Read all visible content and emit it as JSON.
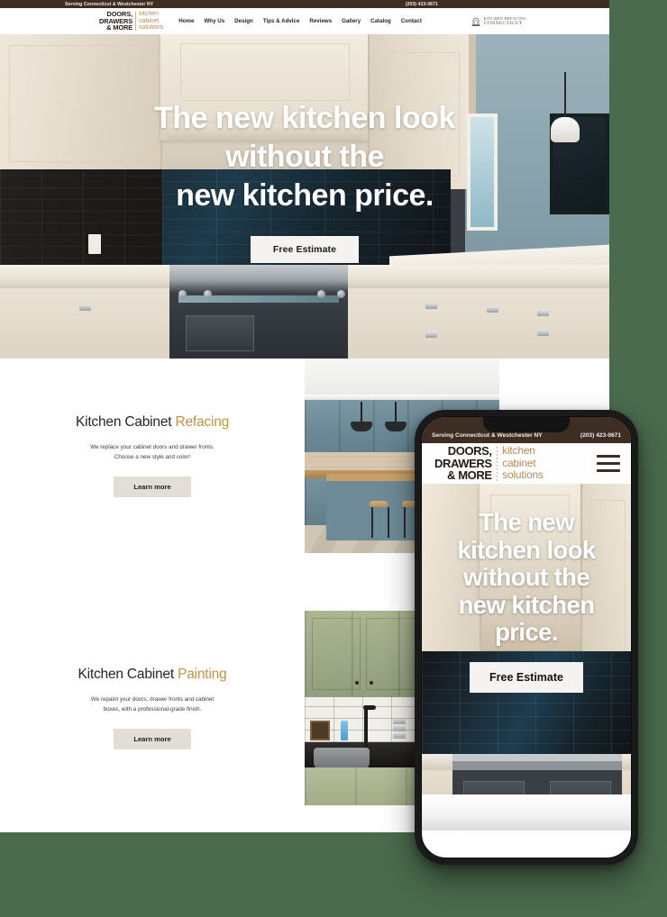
{
  "desktop": {
    "topbar": {
      "tagline": "Serving Connecticut & Westchester NY",
      "phone": "(203) 423-0671"
    },
    "logo": {
      "line1": "DOORS,",
      "line2": "DRAWERS",
      "line3": "& MORE",
      "sub1": "kitchen",
      "sub2": "cabinet",
      "sub3": "solutions"
    },
    "nav": [
      {
        "label": "Home"
      },
      {
        "label": "Why Us"
      },
      {
        "label": "Design"
      },
      {
        "label": "Tips & Advice"
      },
      {
        "label": "Reviews"
      },
      {
        "label": "Gallery"
      },
      {
        "label": "Catalog"
      },
      {
        "label": "Contact"
      }
    ],
    "partner_badge": {
      "line1": "KITCHEN REFACING",
      "line2": "CONNECTICUT"
    },
    "hero": {
      "line1": "The new kitchen look",
      "line2": "without the",
      "line3": "new kitchen price.",
      "cta": "Free Estimate"
    },
    "features": [
      {
        "title_plain": "Kitchen Cabinet ",
        "title_accent": "Refacing",
        "desc_line1": "We replace your cabinet doors and drawer fronts.",
        "desc_line2": "Choose a new style and color!",
        "cta": "Learn more"
      },
      {
        "title_plain": "Kitchen Cabinet ",
        "title_accent": "Painting",
        "desc_line1": "We repaint your doors, drawer fronts and cabinet",
        "desc_line2": "boxes, with a professional-grade finish.",
        "cta": "Learn more"
      }
    ]
  },
  "phone": {
    "topbar": {
      "tagline": "Serving Connecticut & Westchester NY",
      "phone": "(203) 423-0671"
    },
    "logo": {
      "line1": "DOORS,",
      "line2": "DRAWERS",
      "line3": "& MORE",
      "sub1": "kitchen",
      "sub2": "cabinet",
      "sub3": "solutions"
    },
    "hero": {
      "line1": "The new",
      "line2": "kitchen look",
      "line3": "without the",
      "line4": "new kitchen",
      "line5": "price.",
      "cta": "Free Estimate"
    }
  },
  "colors": {
    "background": "#4a6b4d",
    "topbar": "#3d2d22",
    "accent_gold": "#c0923f",
    "logo_tan": "#b08d5e",
    "button_light": "#f4f3f1",
    "button_grey": "#e2ded6"
  }
}
